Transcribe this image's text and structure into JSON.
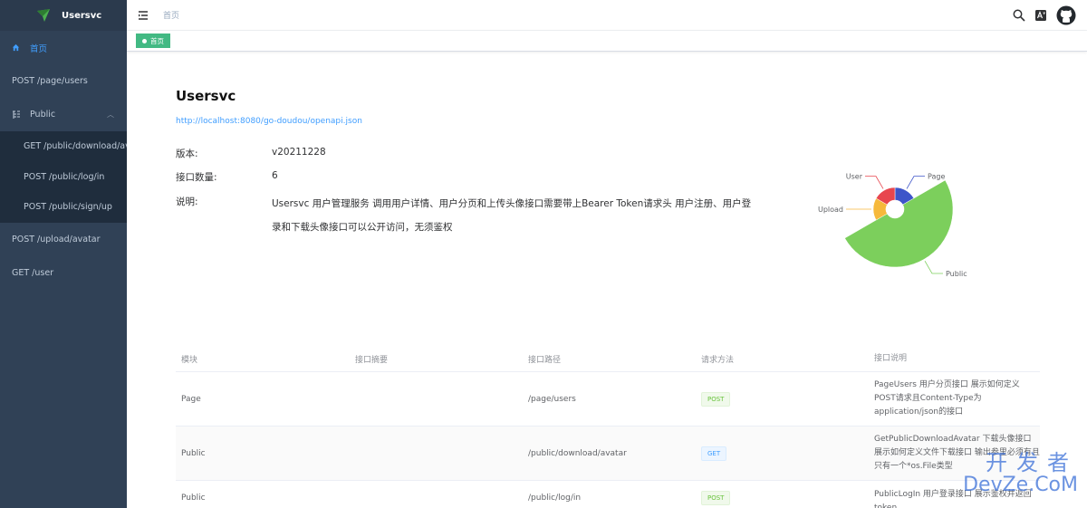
{
  "app": {
    "title": "Usersvc"
  },
  "sidebar": {
    "items": [
      {
        "label": "首页",
        "active": true
      },
      {
        "label": "POST /page/users"
      },
      {
        "label": "Public"
      },
      {
        "label": "GET /public/download/avatar"
      },
      {
        "label": "POST /public/log/in"
      },
      {
        "label": "POST /public/sign/up"
      },
      {
        "label": "POST /upload/avatar"
      },
      {
        "label": "GET /user"
      }
    ]
  },
  "header": {
    "breadcrumb": "首页"
  },
  "tags": {
    "active_tag": "首页"
  },
  "main": {
    "title": "Usersvc",
    "link": "http://localhost:8080/go-doudou/openapi.json",
    "version_label": "版本:",
    "version_value": "v20211228",
    "count_label": "接口数量:",
    "count_value": "6",
    "desc_label": "说明:",
    "desc_value": "Usersvc 用户管理服务 调用用户详情、用户分页和上传头像接口需要带上Bearer Token请求头 用户注册、用户登录和下载头像接口可以公开访问，无须鉴权"
  },
  "chart_data": {
    "type": "pie",
    "labels": [
      "Page",
      "Public",
      "Upload",
      "User"
    ],
    "values": [
      1,
      3,
      1,
      1
    ],
    "colors": [
      "#3e55c9",
      "#7ccf5c",
      "#f6b93b",
      "#e8464e"
    ]
  },
  "table": {
    "headers": [
      "模块",
      "接口摘要",
      "接口路径",
      "请求方法",
      "接口说明"
    ],
    "rows": [
      {
        "module": "Page",
        "summary": "",
        "path": "/page/users",
        "method": "POST",
        "desc": "PageUsers 用户分页接口 展示如何定义POST请求且Content-Type为application/json的接口"
      },
      {
        "module": "Public",
        "summary": "",
        "path": "/public/download/avatar",
        "method": "GET",
        "desc": "GetPublicDownloadAvatar 下载头像接口 展示如何定义文件下载接口 输出参里必须有且只有一个*os.File类型"
      },
      {
        "module": "Public",
        "summary": "",
        "path": "/public/log/in",
        "method": "POST",
        "desc": "PublicLogIn 用户登录接口 展示鉴权并返回token"
      }
    ]
  },
  "watermark": {
    "cn": "开发者",
    "en": "DevZe.CoM"
  }
}
